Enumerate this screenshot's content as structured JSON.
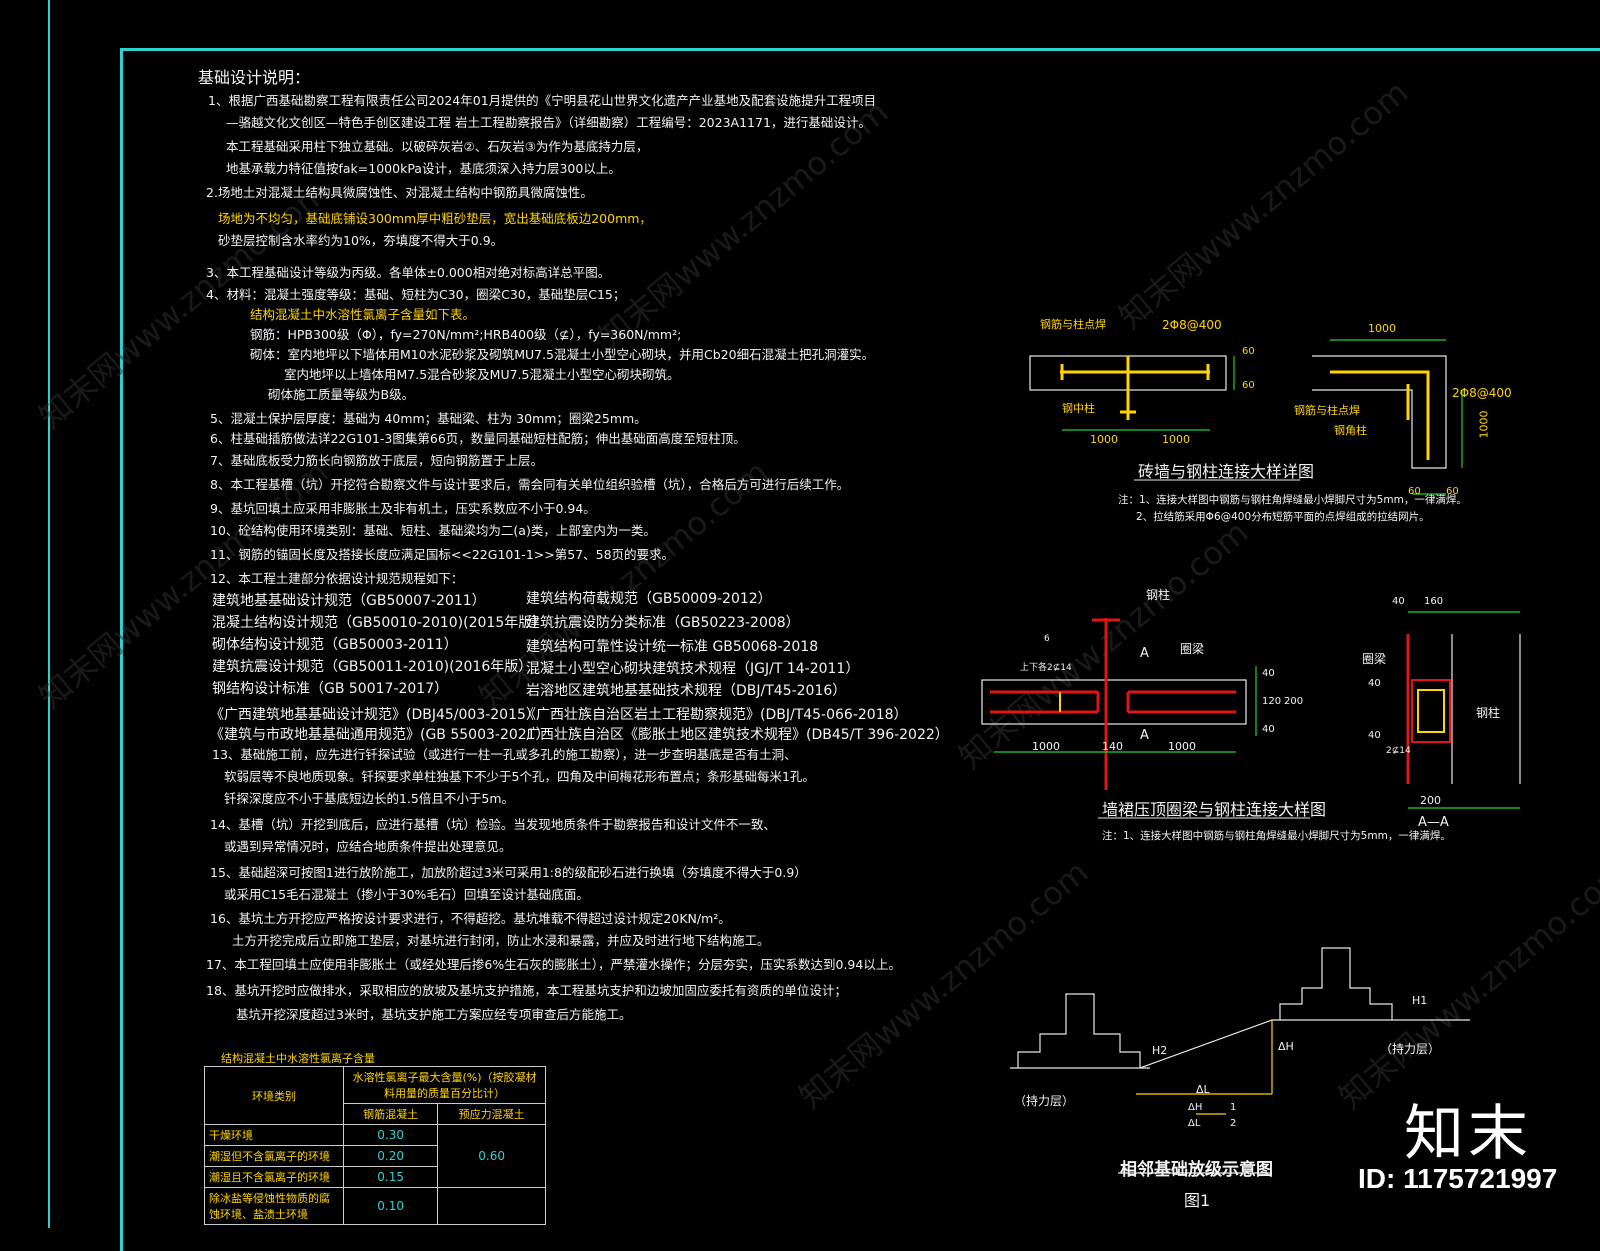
{
  "notes": {
    "title": "基础设计说明：",
    "lines": [
      {
        "text": "1、根据广西基础勘察工程有限责任公司2024年01月提供的《宁明县花山世界文化遗产产业基地及配套设施提升工程项目",
        "color": "w"
      },
      {
        "text": "—骆越文化文创区—特色手创区建设工程 岩土工程勘察报告》（详细勘察）工程编号：2023A1171，进行基础设计。",
        "color": "w"
      },
      {
        "text": "本工程基础采用柱下独立基础。以破碎灰岩②、石灰岩③为作为基底持力层，",
        "color": "w"
      },
      {
        "text": "地基承载力特征值按fak=1000kPa设计，基底须深入持力层300以上。",
        "color": "w"
      },
      {
        "text": "2.场地土对混凝土结构具微腐蚀性、对混凝土结构中钢筋具微腐蚀性。",
        "color": "w"
      },
      {
        "text": "场地为不均匀，基础底铺设300mm厚中粗砂垫层，宽出基础底板边200mm，",
        "color": "y"
      },
      {
        "text": "砂垫层控制含水率约为10%，夯填度不得大于0.9。",
        "color": "w"
      },
      {
        "text": "3、本工程基础设计等级为丙级。各单体±0.000相对绝对标高详总平图。",
        "color": "w"
      },
      {
        "text": "4、材料：混凝土强度等级：基础、短柱为C30，圈梁C30，基础垫层C15；",
        "color": "w"
      },
      {
        "text": "结构混凝土中水溶性氯离子含量如下表。",
        "color": "y"
      },
      {
        "text": "钢筋：HPB300级（Φ），fy=270N/mm²;HRB400级（⊈），fy=360N/mm²;",
        "color": "w"
      },
      {
        "text": "砌体：室内地坪以下墙体用M10水泥砂浆及砌筑MU7.5混凝土小型空心砌块，并用Cb20细石混凝土把孔洞灌实。",
        "color": "w"
      },
      {
        "text": "室内地坪以上墙体用M7.5混合砂浆及MU7.5混凝土小型空心砌块砌筑。",
        "color": "w"
      },
      {
        "text": "砌体施工质量等级为B级。",
        "color": "w"
      },
      {
        "text": "5、混凝土保护层厚度：基础为 40mm；基础梁、柱为 30mm；圈梁25mm。",
        "color": "w"
      },
      {
        "text": "6、柱基础插筋做法详22G101-3图集第66页，数量同基础短柱配筋；伸出基础面高度至短柱顶。",
        "color": "w"
      },
      {
        "text": "7、基础底板受力筋长向钢筋放于底层，短向钢筋置于上层。",
        "color": "w"
      },
      {
        "text": "8、本工程基槽（坑）开挖符合勘察文件与设计要求后，需会同有关单位组织验槽（坑），合格后方可进行后续工作。",
        "color": "w"
      },
      {
        "text": "9、基坑回填土应采用非膨胀土及非有机土，压实系数应不小于0.94。",
        "color": "w"
      },
      {
        "text": "10、砼结构使用环境类别：基础、短柱、基础梁均为二(a)类，上部室内为一类。",
        "color": "w"
      },
      {
        "text": "11、钢筋的锚固长度及搭接长度应满足国标<<22G101-1>>第57、58页的要求。",
        "color": "w"
      },
      {
        "text": "12、本工程土建部分依据设计规范规程如下：",
        "color": "w"
      },
      {
        "text": "13、基础施工前，应先进行钎探试验（或进行一柱一孔或多孔的施工勘察），进一步查明基底是否有土洞、",
        "color": "w"
      },
      {
        "text": "软弱层等不良地质现象。钎探要求单柱独基下不少于5个孔，四角及中间梅花形布置点；条形基础每米1孔。",
        "color": "w"
      },
      {
        "text": "钎探深度应不小于基底短边长的1.5倍且不小于5m。",
        "color": "w"
      },
      {
        "text": "14、基槽（坑）开挖到底后，应进行基槽（坑）检验。当发现地质条件于勘察报告和设计文件不一致、",
        "color": "w"
      },
      {
        "text": "或遇到异常情况时，应结合地质条件提出处理意见。",
        "color": "w"
      },
      {
        "text": "15、基础超深可按图1进行放阶施工，加放阶超过3米可采用1:8的级配砂石进行换填（夯填度不得大于0.9）",
        "color": "w"
      },
      {
        "text": "或采用C15毛石混凝土（掺小于30%毛石）回填至设计基础底面。",
        "color": "w"
      },
      {
        "text": "16、基坑土方开挖应严格按设计要求进行，不得超挖。基坑堆载不得超过设计规定20KN/m²。",
        "color": "w"
      },
      {
        "text": "土方开挖完成后立即施工垫层，对基坑进行封闭，防止水浸和暴露，并应及时进行地下结构施工。",
        "color": "w"
      },
      {
        "text": "17、本工程回填土应使用非膨胀土（或经处理后掺6%生石灰的膨胀土），严禁灌水操作；分层夯实，压实系数达到0.94以上。",
        "color": "w"
      },
      {
        "text": "18、基坑开挖时应做排水，采取相应的放坡及基坑支护措施，本工程基坑支护和边坡加固应委托有资质的单位设计；",
        "color": "w"
      },
      {
        "text": "基坑开挖深度超过3米时，基坑支护施工方案应经专项审查后方能施工。",
        "color": "w"
      }
    ]
  },
  "codes": {
    "left": [
      "建筑地基基础设计规范（GB50007-2011）",
      "混凝土结构设计规范（GB50010-2010)(2015年版）",
      "砌体结构设计规范（GB50003-2011）",
      "建筑抗震设计规范（GB50011-2010)(2016年版）",
      "钢结构设计标准（GB 50017-2017）",
      "《广西建筑地基基础设计规范》(DBJ45/003-2015）",
      "《建筑与市政地基基础通用规范》(GB 55003-2021）"
    ],
    "right": [
      "建筑结构荷载规范（GB50009-2012）",
      "建筑抗震设防分类标准（GB50223-2008）",
      "建筑结构可靠性设计统一标准   GB50068-2018",
      "混凝土小型空心砌块建筑技术规程（JGJ/T 14-2011）",
      "岩溶地区建筑地基基础技术规程（DBJ/T45-2016）",
      "《广西壮族自治区岩土工程勘察规范》(DBJ/T45-066-2018）",
      "广西壮族自治区《膨胀土地区建筑技术规程》(DB45/T 396-2022）"
    ]
  },
  "ion_table": {
    "title": "结构混凝土中水溶性氯离子含量",
    "h_env": "环境类别",
    "h_max": "水溶性氯离子最大含量(%)（按胶凝材料用量的质量百分比计）",
    "h_rc": "钢筋混凝土",
    "h_pc": "预应力混凝土",
    "rows": [
      {
        "env": "干燥环境",
        "rc": "0.30"
      },
      {
        "env": "潮湿但不含氯离子的环境",
        "rc": "0.20"
      },
      {
        "env": "潮湿且不含氯离子的环境",
        "rc": "0.15"
      },
      {
        "env": "除冰盐等侵蚀性物质的腐蚀环境、盐渍土环境",
        "rc": "0.10"
      }
    ],
    "pc_value": "0.60"
  },
  "detail1": {
    "title": "砖墙与钢柱连接大样详图",
    "label_rebar_weld": "钢筋与柱点焊",
    "label_spec": "2Φ8@400",
    "label_mid_col": "钢中柱",
    "label_corner_col": "钢角柱",
    "label_rebar_weld2": "钢筋与柱点焊",
    "dim_1000": "1000",
    "dim_60": "60",
    "note1": "注：1、连接大样图中钢筋与钢柱角焊缝最小焊脚尺寸为5mm，一律满焊。",
    "note2": "2、拉结筋采用Φ6@400分布短筋平面的点焊组成的拉结网片。"
  },
  "detail2": {
    "title": "墙裙压顶圈梁与钢柱连接大样图",
    "label_col": "钢柱",
    "label_ring": "圈梁",
    "label_a": "A",
    "label_rebar": "上下各2⊈14",
    "label_six": "6",
    "dim_1000": "1000",
    "dim_140": "140",
    "dim_40": "40",
    "dim_120": "120",
    "dim_200": "200",
    "note": "注：1、连接大样图中钢筋与钢柱角焊缝最小焊脚尺寸为5mm，一律满焊。"
  },
  "section_aa": {
    "title": "A—A",
    "label_ring": "圈梁",
    "label_col": "钢柱",
    "label_rebar": "2⊈14",
    "dim_40": "40",
    "dim_160": "160",
    "dim_200": "200"
  },
  "figure1": {
    "title": "相邻基础放级示意图",
    "sub": "图1",
    "label_bearing": "（持力层）",
    "label_h1": "H1",
    "label_h2": "H2",
    "label_dh": "ΔH",
    "label_dl": "ΔL",
    "ratio_num": "1",
    "ratio_den": "2"
  },
  "brand": {
    "logo": "知末",
    "id": "ID: 1175721997",
    "watermark": "知末网www.znzmo.com"
  },
  "colors": {
    "frame": "#2fd0d0",
    "yellow": "#ffd400",
    "red": "#e01515",
    "green": "#22cc33"
  }
}
